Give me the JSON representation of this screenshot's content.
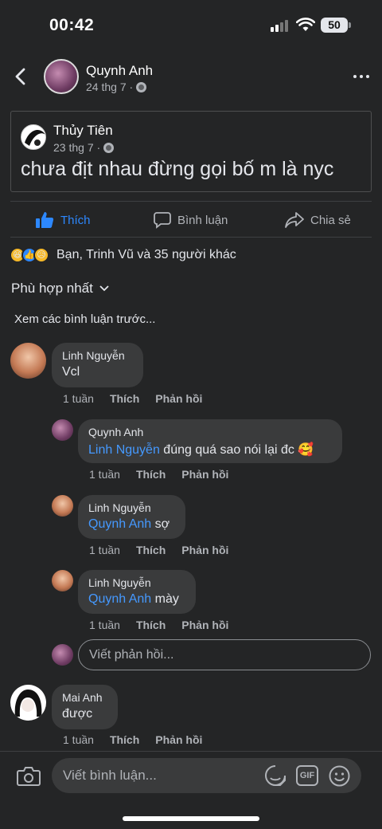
{
  "status_bar": {
    "time": "00:42",
    "battery": "50"
  },
  "header": {
    "author": "Quynh Anh",
    "date": "24 thg 7 ·"
  },
  "shared_post": {
    "author": "Thủy Tiên",
    "date": "23 thg 7 ·",
    "text": "chưa địt nhau đừng gọi bố m là nyc"
  },
  "actions": {
    "like": "Thích",
    "comment": "Bình luận",
    "share": "Chia sẻ"
  },
  "reactions": {
    "emojis": [
      "😆",
      "👍",
      "😥"
    ],
    "summary": "Bạn, Trinh Vũ và 35 người khác"
  },
  "sort_label": "Phù hợp nhất",
  "view_previous": "Xem các bình luận trước...",
  "comments": [
    {
      "name": "Linh Nguyễn",
      "text": "Vcl",
      "time": "1 tuần",
      "like": "Thích",
      "reply": "Phản hồi"
    },
    {
      "name": "Quynh Anh",
      "mention": "Linh Nguyễn",
      "text": " đúng quá sao nói lại đc 🥰",
      "time": "1 tuần",
      "like": "Thích",
      "reply": "Phản hồi"
    },
    {
      "name": "Linh Nguyễn",
      "mention": "Quynh Anh",
      "text": " sợ",
      "time": "1 tuần",
      "like": "Thích",
      "reply": "Phản hồi"
    },
    {
      "name": "Linh Nguyễn",
      "mention": "Quynh Anh",
      "text": " mày",
      "time": "1 tuần",
      "like": "Thích",
      "reply": "Phản hồi"
    },
    {
      "name": "Mai Anh",
      "text": "được",
      "time": "1 tuần",
      "like": "Thích",
      "reply": "Phản hồi"
    }
  ],
  "reply_placeholder": "Viết phản hồi...",
  "comment_placeholder": "Viết bình luận...",
  "gif_label": "GIF",
  "colors": {
    "background": "#242526",
    "bubble": "#3a3b3c",
    "accent": "#2d88ff",
    "mention": "#4599ff"
  }
}
